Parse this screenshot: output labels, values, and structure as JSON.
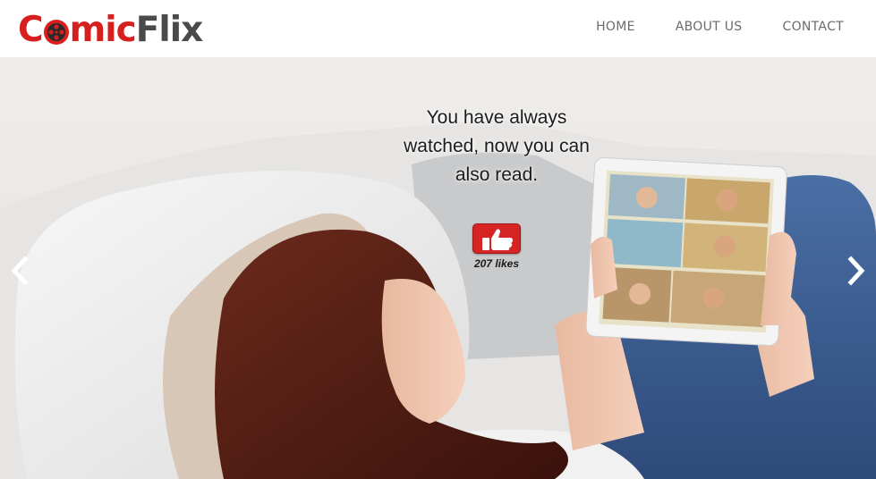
{
  "brand": {
    "part_red": "Co",
    "part_red2": "mic",
    "part_gray": "Flix",
    "red": "#d7201e",
    "gray": "#4a4a4a"
  },
  "nav": {
    "items": [
      {
        "label": "HOME"
      },
      {
        "label": "ABOUT US"
      },
      {
        "label": "CONTACT"
      }
    ]
  },
  "hero": {
    "tagline": "You have always watched, now you can also read.",
    "likes_count": "207",
    "likes_label": "likes",
    "like_icon": "thumbs-up-icon",
    "prev_icon": "chevron-left-icon",
    "next_icon": "chevron-right-icon"
  }
}
